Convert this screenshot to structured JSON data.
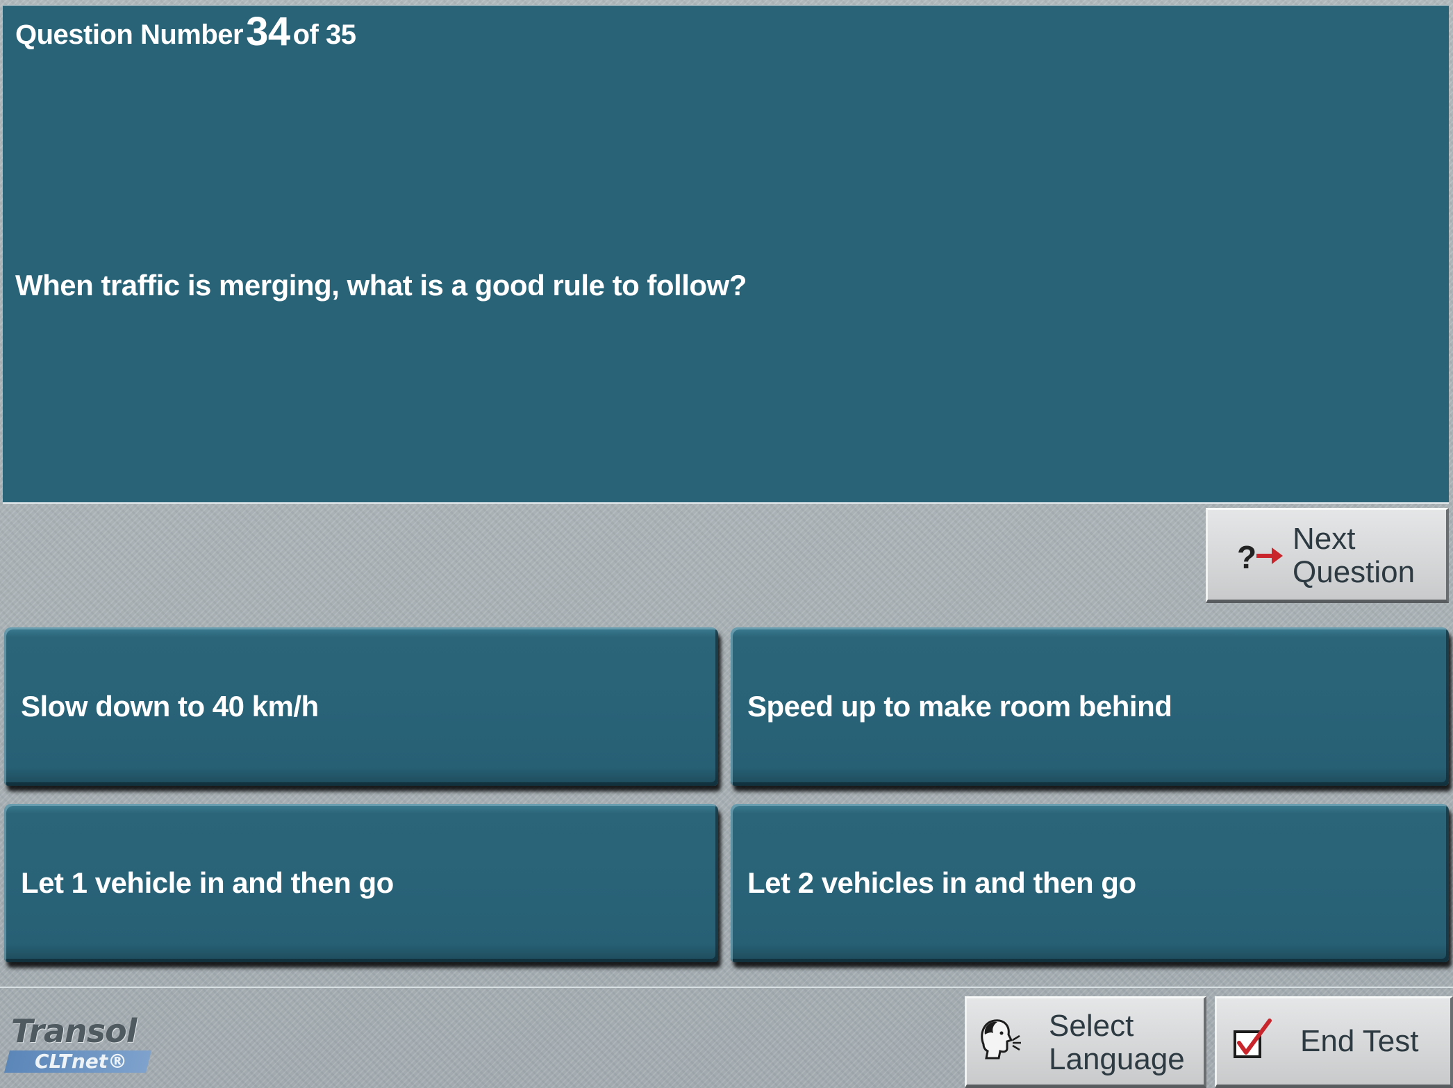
{
  "header": {
    "counter_prefix": "Question Number",
    "counter_current": "34",
    "counter_suffix": "of 35"
  },
  "question": {
    "text": "When traffic is merging, what is a good rule to follow?"
  },
  "answers": [
    {
      "label": "Slow down to 40 km/h"
    },
    {
      "label": "Speed up to make room behind"
    },
    {
      "label": "Let 1 vehicle in and then go"
    },
    {
      "label": "Let 2 vehicles in and then go"
    }
  ],
  "nav": {
    "next_label_line1": "Next",
    "next_label_line2": "Question",
    "next_icon": "question-arrow-icon"
  },
  "footer": {
    "logo_name": "Transol",
    "logo_sub": "CLTnet®",
    "select_language_line1": "Select",
    "select_language_line2": "Language",
    "select_language_icon": "speaking-head-icon",
    "end_test_label": "End Test",
    "end_test_icon": "checkbox-check-icon"
  },
  "colors": {
    "panel": "#296378",
    "background_grey": "#a9b1b6",
    "button_grey": "#d4d6d7",
    "arrow_red": "#c8262c",
    "logo_blue": "#5b86b8"
  }
}
